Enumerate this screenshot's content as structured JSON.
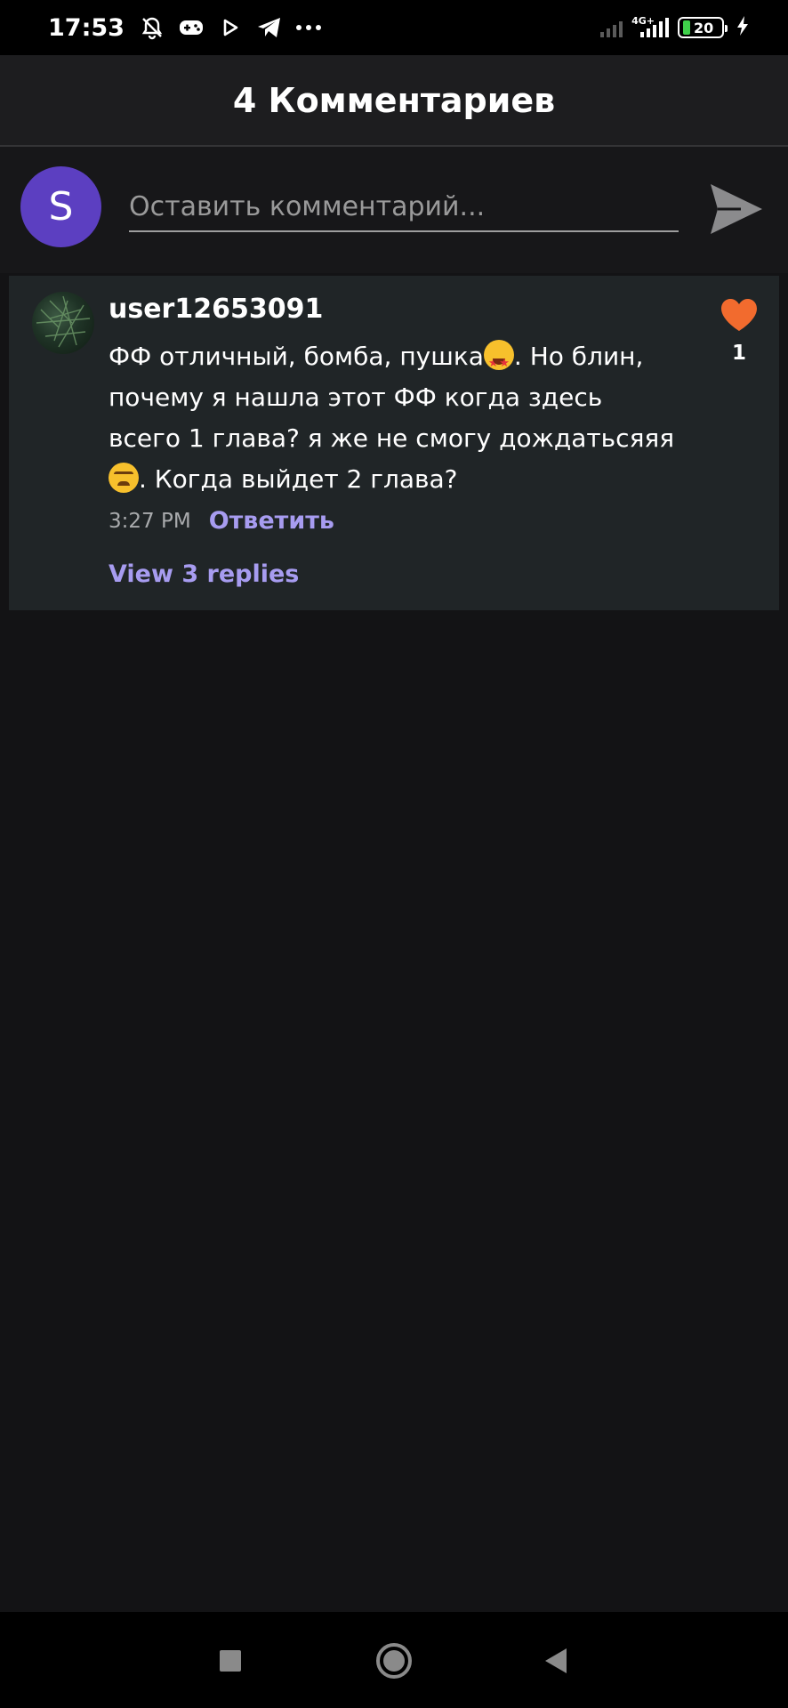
{
  "status_bar": {
    "time": "17:53",
    "network": "4G+",
    "battery": "20",
    "icons": [
      "mute-bell-icon",
      "gamepad-icon",
      "play-icon",
      "telegram-icon",
      "more-dots-icon",
      "signal-icon",
      "battery-icon",
      "charging-icon"
    ]
  },
  "header": {
    "title": "4 Комментариев"
  },
  "compose": {
    "avatar_letter": "S",
    "avatar_color": "#5c3fc1",
    "placeholder": "Оставить комментарий...",
    "send_icon": "send-icon"
  },
  "comments": [
    {
      "username": "user12653091",
      "text_part1": "ФФ отличный, бомба, пушка",
      "text_part2": ". Но блин, почему я нашла этот ФФ когда здесь всего 1 глава? я же не смогу дождатьсяяя",
      "text_part3": ". Когда выйдет 2 глава?",
      "emoji1": "star-struck",
      "emoji2": "tired-face",
      "time": "3:27 PM",
      "reply_label": "Ответить",
      "view_replies_label": "View 3 replies",
      "likes": "1",
      "like_color": "#f26b2e"
    }
  ],
  "colors": {
    "background": "#131315",
    "header_bg": "#1d1d1f",
    "card_bg": "#202527",
    "link": "#a79cf0"
  }
}
